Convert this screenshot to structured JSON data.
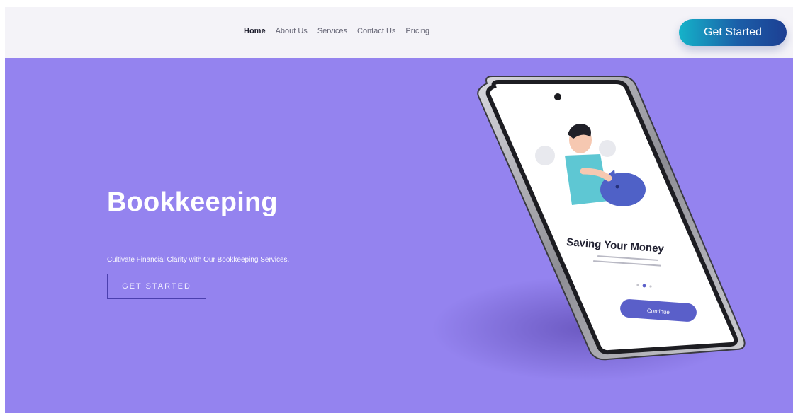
{
  "nav": {
    "items": [
      {
        "label": "Home",
        "active": true
      },
      {
        "label": "About Us",
        "active": false
      },
      {
        "label": "Services",
        "active": false
      },
      {
        "label": "Contact Us",
        "active": false
      },
      {
        "label": "Pricing",
        "active": false
      }
    ],
    "cta_label": "Get Started"
  },
  "hero": {
    "title": "Bookkeeping",
    "subtitle": "Cultivate Financial Clarity with Our Bookkeeping Services.",
    "button_label": "GET STARTED"
  },
  "phone": {
    "screen_title": "Saving Your Money",
    "button_label": "Continue",
    "dots": 3,
    "active_dot": 1
  },
  "colors": {
    "hero_bg": "#9483ef",
    "header_bg": "#f4f3f8",
    "cta_gradient": [
      "#15b3c9",
      "#1d3f93"
    ],
    "phone_button": "#5a5fc9"
  }
}
